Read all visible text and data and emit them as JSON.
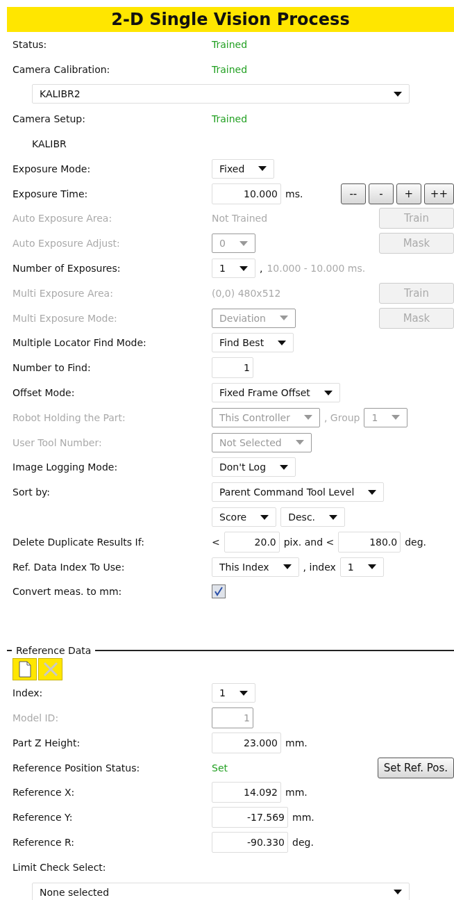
{
  "title": "2-D Single Vision Process",
  "rows": [
    {
      "kind": "field",
      "label": "Status:",
      "disabled": false,
      "items": [
        {
          "kind": "status",
          "text": "Trained"
        }
      ]
    },
    {
      "kind": "field",
      "label": "Camera Calibration:",
      "disabled": false,
      "items": [
        {
          "kind": "status",
          "text": "Trained"
        }
      ]
    },
    {
      "kind": "wide_select",
      "value": "KALIBR2"
    },
    {
      "kind": "field",
      "label": "Camera Setup:",
      "disabled": false,
      "items": [
        {
          "kind": "status",
          "text": "Trained"
        }
      ]
    },
    {
      "kind": "note",
      "text": "KALIBR"
    },
    {
      "kind": "field",
      "label": "Exposure Mode:",
      "disabled": false,
      "items": [
        {
          "kind": "select",
          "value": "Fixed"
        }
      ]
    },
    {
      "kind": "field",
      "label": "Exposure Time:",
      "disabled": false,
      "items": [
        {
          "kind": "input",
          "value": "10.000"
        },
        {
          "kind": "text",
          "text": "ms."
        }
      ],
      "actions": [
        {
          "label": "--",
          "disabled": false
        },
        {
          "label": "-",
          "disabled": false
        },
        {
          "label": "+",
          "disabled": false
        },
        {
          "label": "++",
          "disabled": false
        }
      ]
    },
    {
      "kind": "field",
      "label": "Auto Exposure Area:",
      "disabled": true,
      "items": [
        {
          "kind": "text",
          "text": "Not Trained"
        }
      ],
      "actions": [
        {
          "label": "Train",
          "disabled": true
        }
      ]
    },
    {
      "kind": "field",
      "label": "Auto Exposure Adjust:",
      "disabled": true,
      "items": [
        {
          "kind": "select",
          "value": "0"
        }
      ],
      "actions": [
        {
          "label": "Mask",
          "disabled": true
        }
      ]
    },
    {
      "kind": "field",
      "label": "Number of Exposures:",
      "disabled": false,
      "items": [
        {
          "kind": "select",
          "value": "1"
        },
        {
          "kind": "text",
          "text": ","
        },
        {
          "kind": "hint",
          "text": "10.000 - 10.000 ms."
        }
      ]
    },
    {
      "kind": "field",
      "label": "Multi Exposure Area:",
      "disabled": true,
      "items": [
        {
          "kind": "text",
          "text": "(0,0) 480x512"
        }
      ],
      "actions": [
        {
          "label": "Train",
          "disabled": true
        }
      ]
    },
    {
      "kind": "field",
      "label": "Multi Exposure Mode:",
      "disabled": true,
      "items": [
        {
          "kind": "select",
          "value": "Deviation"
        }
      ],
      "actions": [
        {
          "label": "Mask",
          "disabled": true
        }
      ]
    },
    {
      "kind": "field",
      "label": "Multiple Locator Find Mode:",
      "disabled": false,
      "items": [
        {
          "kind": "select",
          "value": "Find Best"
        }
      ]
    },
    {
      "kind": "field",
      "label": "Number to Find:",
      "disabled": false,
      "items": [
        {
          "kind": "input",
          "value": "1"
        }
      ]
    },
    {
      "kind": "field",
      "label": "Offset Mode:",
      "disabled": false,
      "items": [
        {
          "kind": "select",
          "value": "Fixed Frame Offset"
        }
      ]
    },
    {
      "kind": "field",
      "label": "Robot Holding the Part:",
      "disabled": true,
      "items": [
        {
          "kind": "select",
          "value": "This Controller"
        },
        {
          "kind": "text",
          "text": ", Group"
        },
        {
          "kind": "select",
          "value": "1"
        }
      ]
    },
    {
      "kind": "field",
      "label": "User Tool Number:",
      "disabled": true,
      "items": [
        {
          "kind": "select",
          "value": "Not Selected"
        }
      ]
    },
    {
      "kind": "field",
      "label": "Image Logging Mode:",
      "disabled": false,
      "items": [
        {
          "kind": "select",
          "value": "Don't Log"
        }
      ]
    },
    {
      "kind": "field",
      "label": "Sort by:",
      "disabled": false,
      "items": [
        {
          "kind": "select",
          "value": "Parent Command Tool Level"
        }
      ]
    },
    {
      "kind": "field",
      "items": [
        {
          "kind": "select",
          "value": "Score"
        },
        {
          "kind": "select",
          "value": "Desc."
        }
      ]
    },
    {
      "kind": "field",
      "label": "Delete Duplicate Results If:",
      "disabled": false,
      "items": [
        {
          "kind": "text",
          "text": "<"
        },
        {
          "kind": "input",
          "value": "20.0"
        },
        {
          "kind": "text",
          "text": "pix. and <"
        },
        {
          "kind": "input",
          "value": "180.0"
        },
        {
          "kind": "text",
          "text": "deg."
        }
      ]
    },
    {
      "kind": "field",
      "label": "Ref. Data Index To Use:",
      "disabled": false,
      "items": [
        {
          "kind": "select",
          "value": "This Index"
        },
        {
          "kind": "text",
          "text": ", index"
        },
        {
          "kind": "select",
          "value": "1"
        }
      ]
    },
    {
      "kind": "field",
      "label": "Convert meas. to mm:",
      "disabled": false,
      "items": [
        {
          "kind": "checkbox",
          "checked": true
        }
      ]
    },
    {
      "kind": "section",
      "title": "Reference Data"
    },
    {
      "kind": "toolbar",
      "tools": [
        {
          "kind": "new",
          "disabled": false
        },
        {
          "kind": "delete",
          "disabled": true
        }
      ]
    },
    {
      "kind": "field",
      "label": "Index:",
      "disabled": false,
      "items": [
        {
          "kind": "select",
          "value": "1"
        }
      ]
    },
    {
      "kind": "field",
      "label": "Model ID:",
      "disabled": true,
      "items": [
        {
          "kind": "input",
          "value": "1"
        }
      ]
    },
    {
      "kind": "field",
      "label": "Part Z Height:",
      "disabled": false,
      "items": [
        {
          "kind": "input",
          "value": "23.000"
        },
        {
          "kind": "text",
          "text": "mm."
        }
      ]
    },
    {
      "kind": "field",
      "label": "Reference Position Status:",
      "disabled": false,
      "items": [
        {
          "kind": "status",
          "text": "Set"
        }
      ],
      "actions": [
        {
          "label": "Set Ref. Pos.",
          "disabled": false
        }
      ]
    },
    {
      "kind": "field",
      "label": "Reference X:",
      "disabled": false,
      "items": [
        {
          "kind": "input",
          "value": "14.092"
        },
        {
          "kind": "text",
          "text": "mm."
        }
      ]
    },
    {
      "kind": "field",
      "label": "Reference Y:",
      "disabled": false,
      "items": [
        {
          "kind": "input",
          "value": "-17.569"
        },
        {
          "kind": "text",
          "text": "mm."
        }
      ]
    },
    {
      "kind": "field",
      "label": "Reference R:",
      "disabled": false,
      "items": [
        {
          "kind": "input",
          "value": "-90.330"
        },
        {
          "kind": "text",
          "text": "deg."
        }
      ]
    },
    {
      "kind": "field",
      "label": "Limit Check Select:",
      "disabled": false,
      "items": []
    },
    {
      "kind": "wide_select",
      "value": "None selected"
    }
  ]
}
